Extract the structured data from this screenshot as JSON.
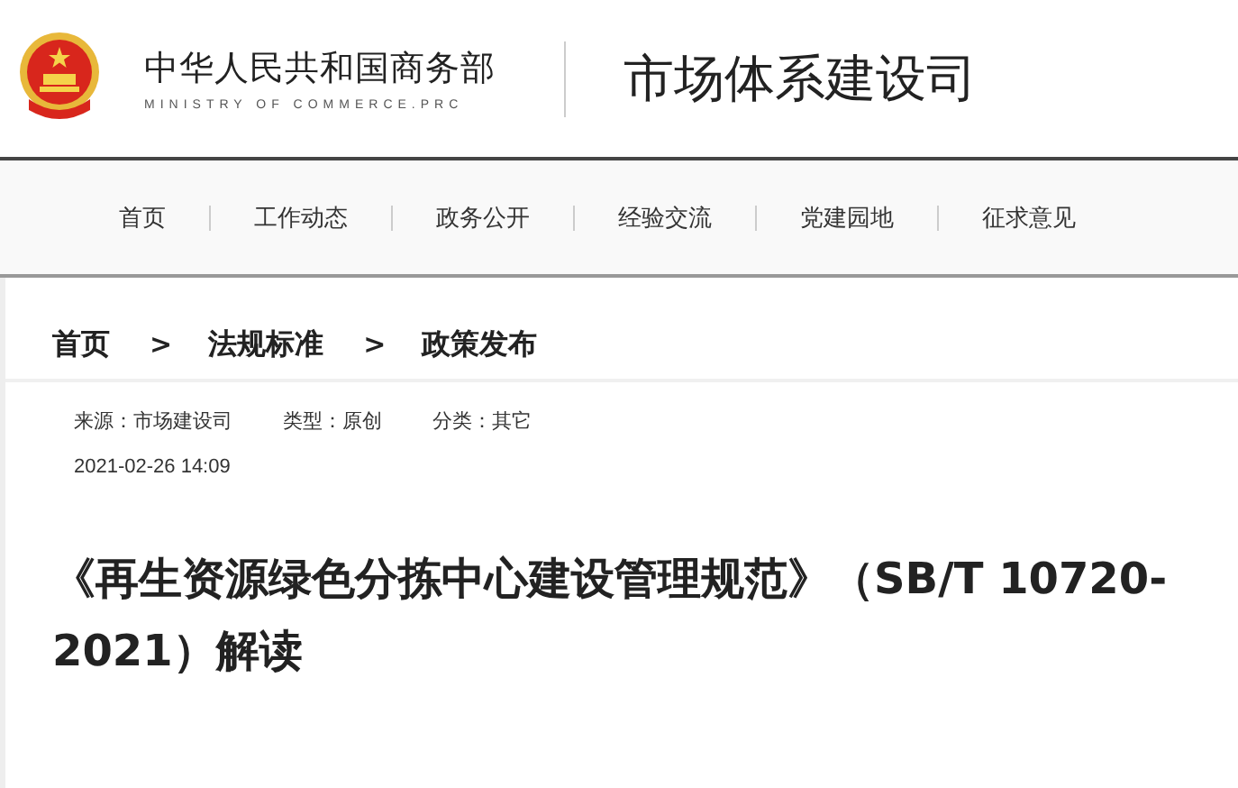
{
  "header": {
    "org_name": "中华人民共和国商务部",
    "org_name_en": "MINISTRY OF COMMERCE.PRC",
    "department": "市场体系建设司"
  },
  "nav": {
    "items": [
      {
        "label": "首页"
      },
      {
        "label": "工作动态"
      },
      {
        "label": "政务公开"
      },
      {
        "label": "经验交流"
      },
      {
        "label": "党建园地"
      },
      {
        "label": "征求意见"
      }
    ]
  },
  "breadcrumb": {
    "items": [
      "首页",
      "法规标准",
      "政策发布"
    ],
    "separator": ">"
  },
  "meta": {
    "fields": [
      {
        "label": "来源：",
        "value": "市场建设司"
      },
      {
        "label": "类型：",
        "value": "原创"
      },
      {
        "label": "分类：",
        "value": "其它"
      }
    ],
    "date": "2021-02-26 14:09"
  },
  "article": {
    "title": "《再生资源绿色分拣中心建设管理规范》（SB/T 10720-2021）解读"
  }
}
